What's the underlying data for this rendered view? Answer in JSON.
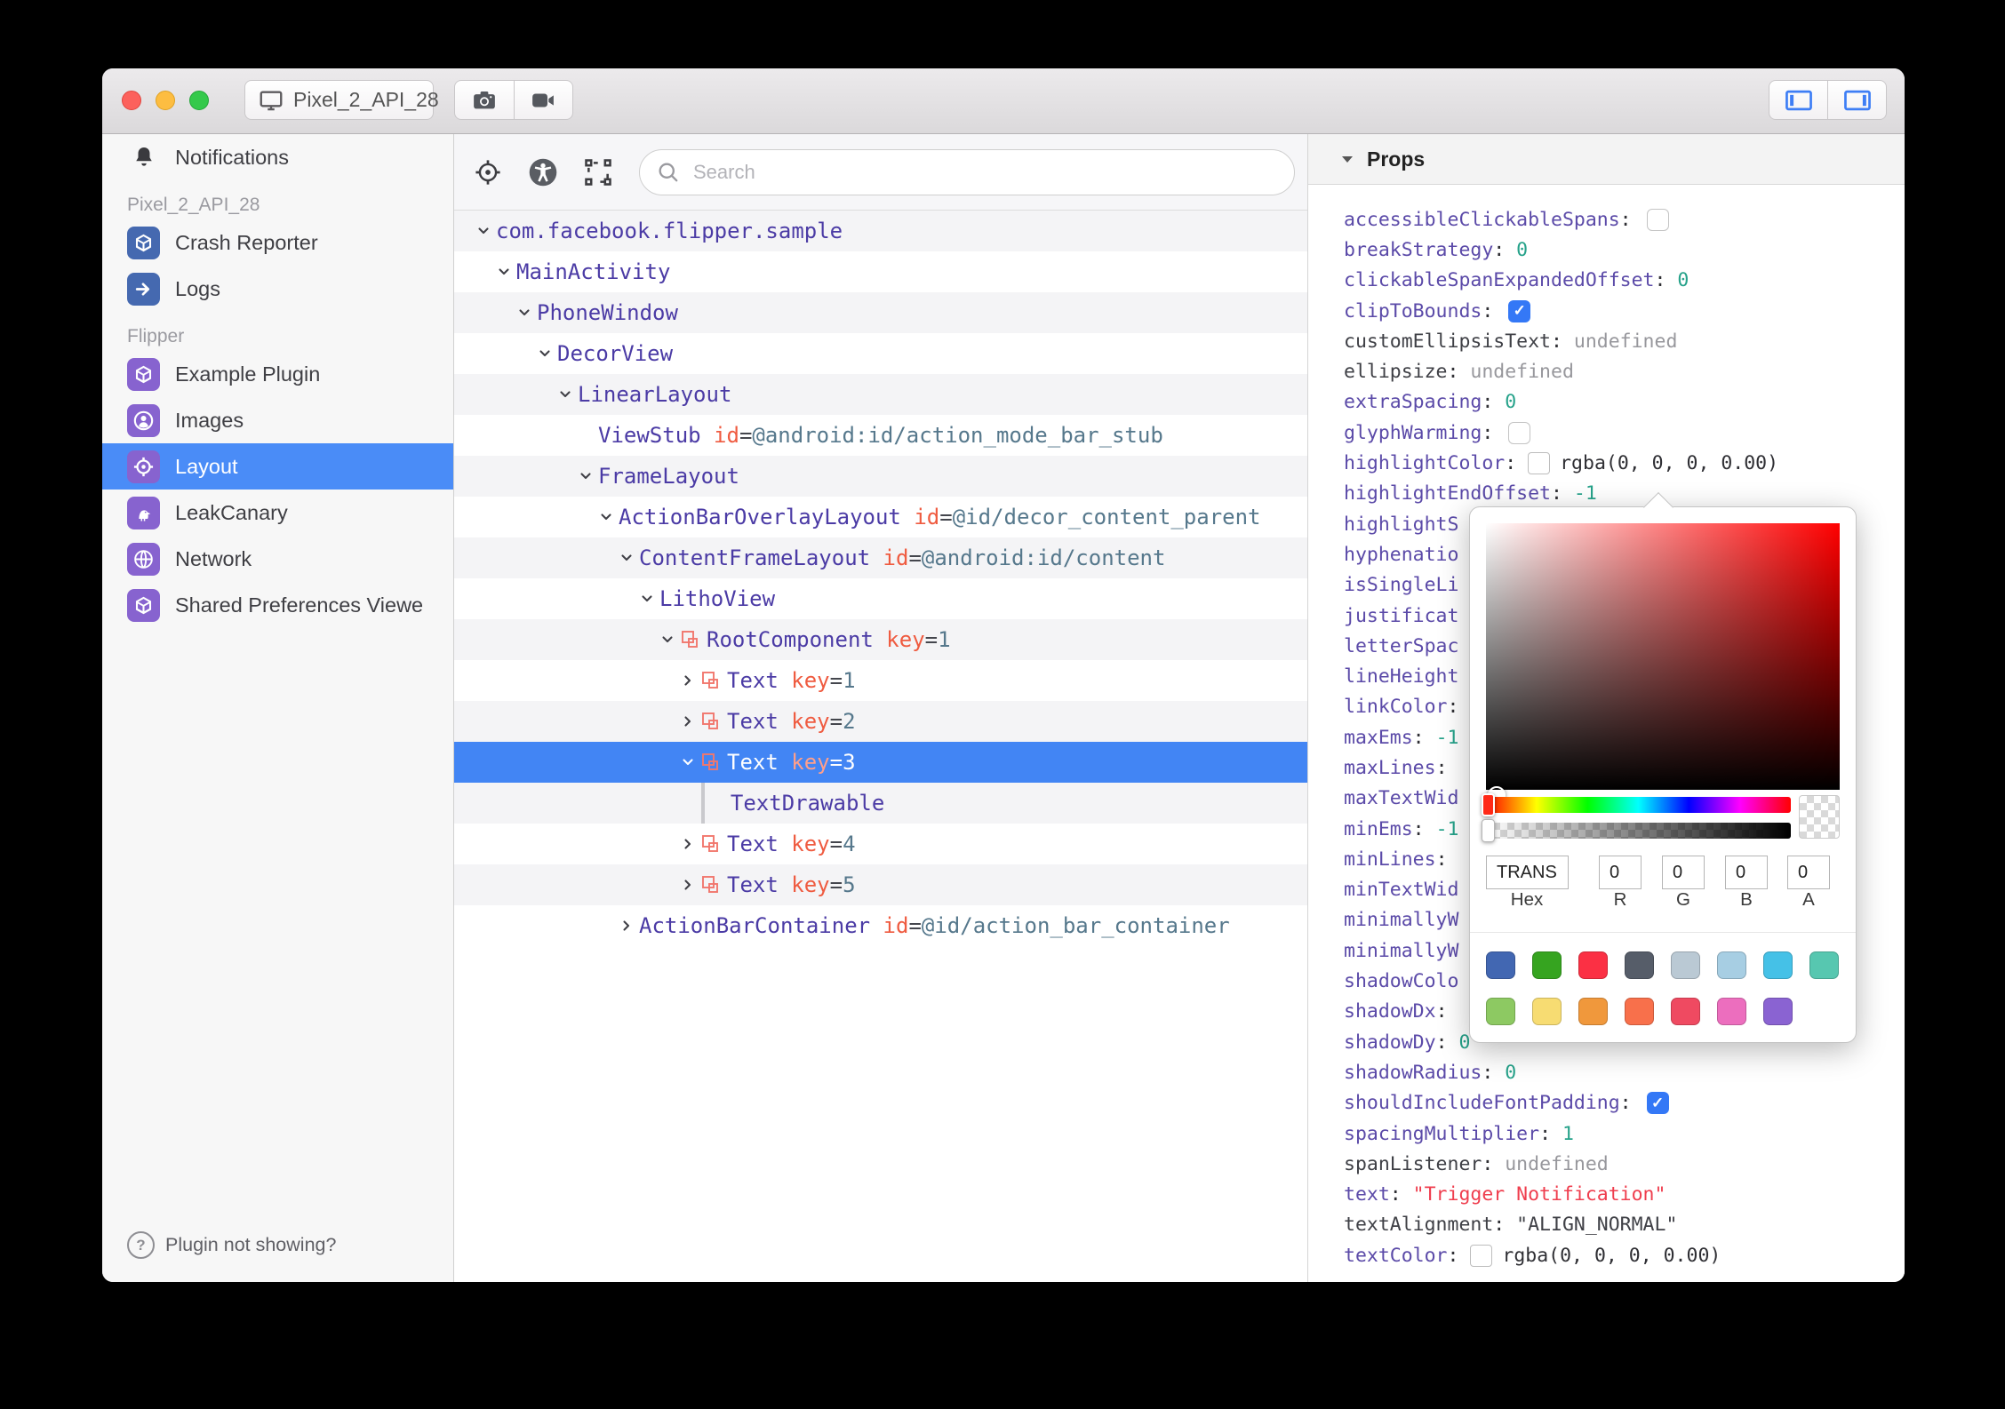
{
  "titlebar": {
    "device": "Pixel_2_API_28",
    "icons": [
      "monitor-icon",
      "camera-icon",
      "video-icon",
      "toggle-left-panel-icon",
      "toggle-right-panel-icon"
    ]
  },
  "sidebar": {
    "entries": [
      {
        "type": "item",
        "label": "Notifications",
        "icon": "bell",
        "plain": true
      },
      {
        "type": "section",
        "label": "Pixel_2_API_28"
      },
      {
        "type": "item",
        "label": "Crash Reporter",
        "icon": "cube",
        "color": "#4569b0"
      },
      {
        "type": "item",
        "label": "Logs",
        "icon": "arrow",
        "color": "#4569b0"
      },
      {
        "type": "section",
        "label": "Flipper"
      },
      {
        "type": "item",
        "label": "Example Plugin",
        "icon": "cube",
        "color": "#8763cf"
      },
      {
        "type": "item",
        "label": "Images",
        "icon": "person",
        "color": "#8763cf"
      },
      {
        "type": "item",
        "label": "Layout",
        "icon": "target",
        "color": "#8763cf",
        "selected": true
      },
      {
        "type": "item",
        "label": "LeakCanary",
        "icon": "bird",
        "color": "#8763cf"
      },
      {
        "type": "item",
        "label": "Network",
        "icon": "globe",
        "color": "#8763cf"
      },
      {
        "type": "item",
        "label": "Shared Preferences Viewe",
        "icon": "cube",
        "color": "#8763cf"
      }
    ],
    "footer": "Plugin not showing?"
  },
  "toolbar": {
    "search_placeholder": "Search"
  },
  "tree": {
    "rows": [
      {
        "d": 0,
        "c": "down",
        "n": "com.facebook.flipper.sample"
      },
      {
        "d": 1,
        "c": "down",
        "n": "MainActivity"
      },
      {
        "d": 2,
        "c": "down",
        "n": "PhoneWindow"
      },
      {
        "d": 3,
        "c": "down",
        "n": "DecorView"
      },
      {
        "d": 4,
        "c": "down",
        "n": "LinearLayout"
      },
      {
        "d": 5,
        "c": "none",
        "n": "ViewStub",
        "a": "id",
        "v": "@android:id/action_mode_bar_stub"
      },
      {
        "d": 5,
        "c": "down",
        "n": "FrameLayout"
      },
      {
        "d": 6,
        "c": "down",
        "n": "ActionBarOverlayLayout",
        "a": "id",
        "v": "@id/decor_content_parent"
      },
      {
        "d": 7,
        "c": "down",
        "n": "ContentFrameLayout",
        "a": "id",
        "v": "@android:id/content"
      },
      {
        "d": 8,
        "c": "down",
        "n": "LithoView"
      },
      {
        "d": 9,
        "c": "down",
        "comp": true,
        "n": "RootComponent",
        "a": "key",
        "v": "1"
      },
      {
        "d": 10,
        "c": "right",
        "comp": true,
        "n": "Text",
        "a": "key",
        "v": "1"
      },
      {
        "d": 10,
        "c": "right",
        "comp": true,
        "n": "Text",
        "a": "key",
        "v": "2"
      },
      {
        "d": 10,
        "c": "down",
        "comp": true,
        "n": "Text",
        "a": "key",
        "v": "3",
        "sel": true
      },
      {
        "d": 11,
        "c": "none",
        "guide": true,
        "n": "TextDrawable"
      },
      {
        "d": 10,
        "c": "right",
        "comp": true,
        "n": "Text",
        "a": "key",
        "v": "4"
      },
      {
        "d": 10,
        "c": "right",
        "comp": true,
        "n": "Text",
        "a": "key",
        "v": "5"
      },
      {
        "d": 7,
        "c": "right",
        "n": "ActionBarContainer",
        "a": "id",
        "v": "@id/action_bar_container"
      }
    ]
  },
  "props": {
    "header": "Props",
    "rows": [
      {
        "name": "accessibleClickableSpans",
        "colon": true,
        "vt": "check-off"
      },
      {
        "name": "breakStrategy",
        "colon": true,
        "vt": "num",
        "value": "0"
      },
      {
        "name": "clickableSpanExpandedOffset",
        "colon": true,
        "vt": "num",
        "value": "0"
      },
      {
        "name": "clipToBounds",
        "colon": true,
        "vt": "check-on"
      },
      {
        "name": "customEllipsisText",
        "colon": true,
        "vt": "undef",
        "value": "undefined",
        "dark": true
      },
      {
        "name": "ellipsize",
        "colon": true,
        "vt": "undef",
        "value": "undefined",
        "dark": true
      },
      {
        "name": "extraSpacing",
        "colon": true,
        "vt": "num",
        "value": "0"
      },
      {
        "name": "glyphWarming",
        "colon": true,
        "vt": "check-off"
      },
      {
        "name": "highlightColor",
        "colon": true,
        "vt": "color",
        "value": "rgba(0, 0, 0, 0.00)"
      },
      {
        "name": "highlightEndOffset",
        "colon": true,
        "vt": "num",
        "value": "-1"
      },
      {
        "name": "highlightS",
        "colon": false
      },
      {
        "name": "hyphenatio",
        "colon": false
      },
      {
        "name": "isSingleLi",
        "colon": false
      },
      {
        "name": "justificat",
        "colon": false
      },
      {
        "name": "letterSpac",
        "colon": false
      },
      {
        "name": "lineHeight",
        "colon": false
      },
      {
        "name": "linkColor",
        "colon": true
      },
      {
        "name": "maxEms",
        "colon": true,
        "vt": "num",
        "value": "-1"
      },
      {
        "name": "maxLines",
        "colon": true
      },
      {
        "name": "maxTextWid",
        "colon": false
      },
      {
        "name": "minEms",
        "colon": true,
        "vt": "num",
        "value": "-1"
      },
      {
        "name": "minLines",
        "colon": true
      },
      {
        "name": "minTextWid",
        "colon": false
      },
      {
        "name": "minimallyW",
        "colon": false
      },
      {
        "name": "minimallyW",
        "colon": false
      },
      {
        "name": "shadowColo",
        "colon": false
      },
      {
        "name": "shadowDx",
        "colon": true
      },
      {
        "name": "shadowDy",
        "colon": true,
        "vt": "num",
        "value": "0"
      },
      {
        "name": "shadowRadius",
        "colon": true,
        "vt": "num",
        "value": "0"
      },
      {
        "name": "shouldIncludeFontPadding",
        "colon": true,
        "vt": "check-on"
      },
      {
        "name": "spacingMultiplier",
        "colon": true,
        "vt": "num",
        "value": "1"
      },
      {
        "name": "spanListener",
        "colon": true,
        "vt": "undef",
        "value": "undefined",
        "dark": true
      },
      {
        "name": "text",
        "colon": true,
        "vt": "str",
        "value": "\"Trigger Notification\""
      },
      {
        "name": "textAlignment",
        "colon": true,
        "vt": "darkstr",
        "value": "\"ALIGN_NORMAL\"",
        "dark": true
      },
      {
        "name": "textColor",
        "colon": true,
        "vt": "color",
        "value": "rgba(0, 0, 0, 0.00)"
      }
    ]
  },
  "color_picker": {
    "hex": "TRANS",
    "r": "0",
    "g": "0",
    "b": "0",
    "a": "0",
    "labels": [
      "Hex",
      "R",
      "G",
      "B",
      "A"
    ],
    "swatches_row1": [
      "#4267b2",
      "#36a420",
      "#fb3044",
      "#565d69",
      "#bac9d4",
      "#a7cee3",
      "#45c1e7",
      "#57c7b0"
    ],
    "swatches_row2": [
      "#8dc962",
      "#f7dc72",
      "#f0983c",
      "#f8704b",
      "#ef4a61",
      "#ec6ebe",
      "#8a63d2"
    ]
  }
}
